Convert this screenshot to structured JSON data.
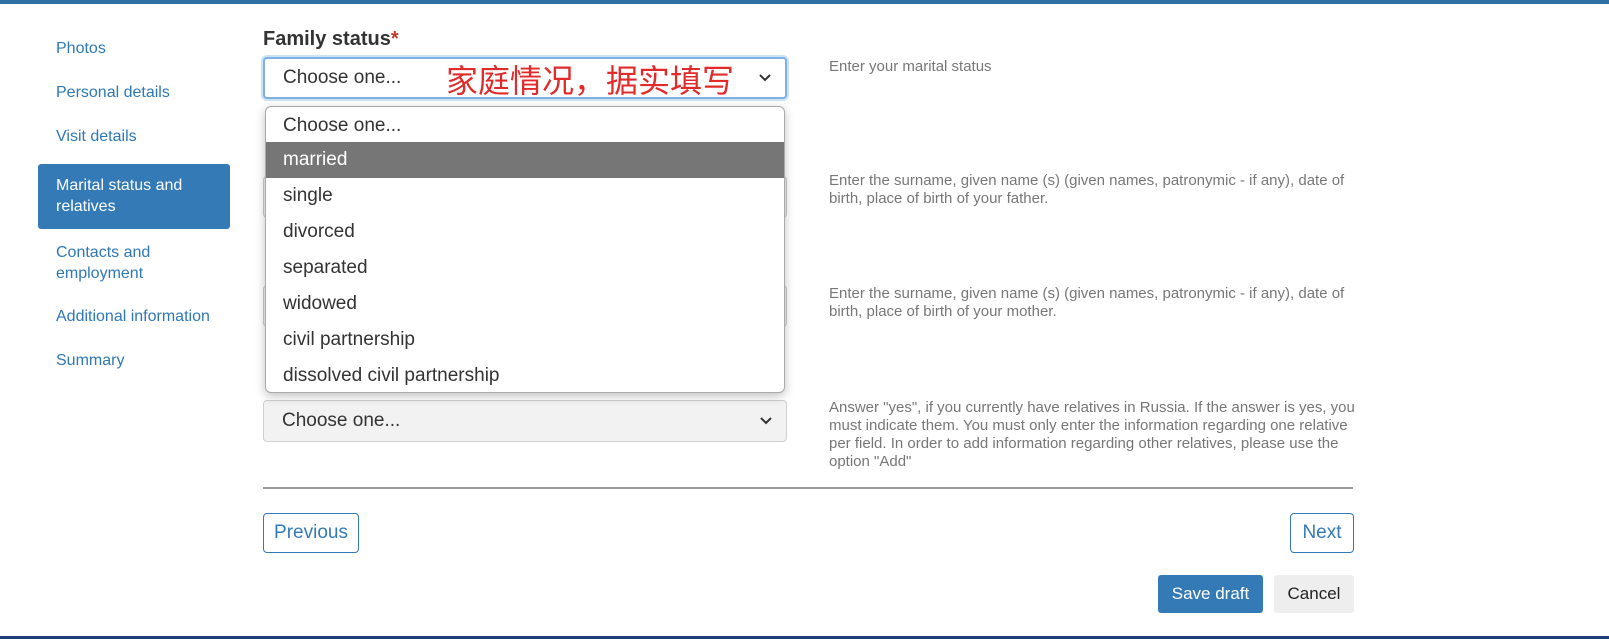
{
  "sidebar": {
    "items": [
      {
        "label": "Photos"
      },
      {
        "label": "Personal details"
      },
      {
        "label": "Visit details"
      },
      {
        "label": "Marital status and relatives"
      },
      {
        "label": "Contacts and employment"
      },
      {
        "label": "Additional information"
      },
      {
        "label": "Summary"
      }
    ],
    "active_index": 3
  },
  "family_status": {
    "label": "Family status",
    "required_mark": "*",
    "selected": "Choose one...",
    "annotation": "家庭情况，据实填写",
    "help": "Enter your marital status",
    "options": [
      "Choose one...",
      "married",
      "single",
      "divorced",
      "separated",
      "widowed",
      "civil partnership",
      "dissolved civil partnership"
    ],
    "highlighted_option": "married"
  },
  "father": {
    "help": "Enter the surname, given name (s) (given names, patronymic - if any), date of birth, place of birth of your father."
  },
  "mother": {
    "help": "Enter the surname, given name (s) (given names, patronymic - if any), date of birth, place of birth of your mother."
  },
  "relatives": {
    "selected": "Choose one...",
    "help": "Answer \"yes\", if you currently have relatives in Russia. If the answer is yes, you must indicate them. You must only enter the information regarding one relative per field. In order to add information regarding other relatives, please use the option \"Add\""
  },
  "buttons": {
    "previous": "Previous",
    "next": "Next",
    "save_draft": "Save draft",
    "cancel": "Cancel"
  },
  "colors": {
    "accent": "#337ab7",
    "highlight_option": "#767676",
    "annotation_red": "#e12a2a"
  },
  "icons": {
    "select_arrow": "chevron-down-icon"
  }
}
